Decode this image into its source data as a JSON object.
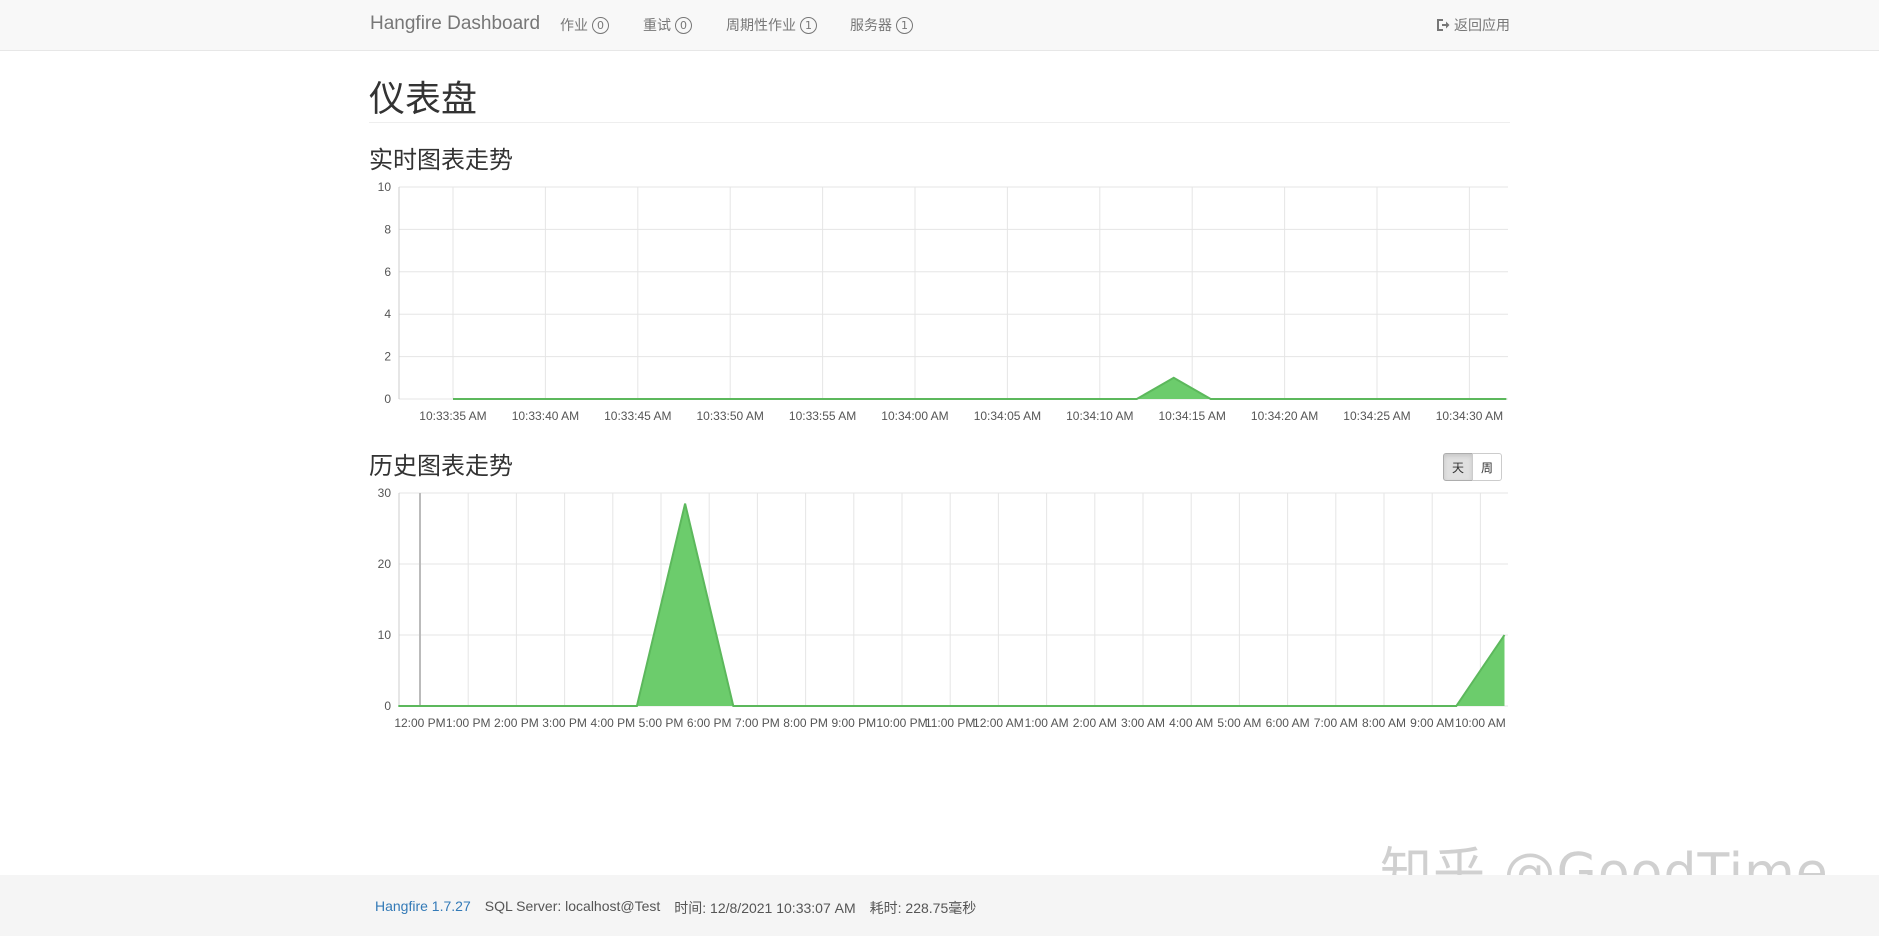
{
  "navbar": {
    "brand": "Hangfire Dashboard",
    "items": [
      {
        "label": "作业",
        "count": "0"
      },
      {
        "label": "重试",
        "count": "0"
      },
      {
        "label": "周期性作业",
        "count": "1"
      },
      {
        "label": "服务器",
        "count": "1"
      }
    ],
    "back_label": "返回应用",
    "back_icon": "sign-out-icon"
  },
  "page": {
    "title": "仪表盘",
    "realtime_title": "实时图表走势",
    "history_title": "历史图表走势"
  },
  "history_toggle": {
    "options": [
      "天",
      "周"
    ],
    "selected": "天"
  },
  "footer": {
    "version": "Hangfire 1.7.27",
    "storage": "SQL Server: localhost@Test",
    "time": "时间: 12/8/2021 10:33:07 AM",
    "duration": "耗时: 228.75毫秒"
  },
  "watermark": "知乎 @GoodTime",
  "colors": {
    "series_fill": "#6ccc6c",
    "series_stroke": "#5cb85c",
    "grid": "#e5e5e5"
  },
  "chart_data": [
    {
      "type": "area",
      "x": [
        "10:33:35 AM",
        "10:33:40 AM",
        "10:33:45 AM",
        "10:33:50 AM",
        "10:33:55 AM",
        "10:34:00 AM",
        "10:34:05 AM",
        "10:34:10 AM",
        "10:34:15 AM",
        "10:34:20 AM",
        "10:34:25 AM",
        "10:34:30 AM"
      ],
      "ylim": [
        0,
        10
      ],
      "yticks": [
        0,
        2,
        4,
        6,
        8,
        10
      ],
      "grid": true,
      "series": [
        {
          "points": [
            [
              0.0,
              0
            ],
            [
              7.0,
              0
            ],
            [
              7.4,
              0
            ],
            [
              7.8,
              1
            ],
            [
              8.2,
              0
            ],
            [
              11.4,
              0
            ]
          ]
        }
      ]
    },
    {
      "type": "area",
      "x": [
        "12:00 PM",
        "1:00 PM",
        "2:00 PM",
        "3:00 PM",
        "4:00 PM",
        "5:00 PM",
        "6:00 PM",
        "7:00 PM",
        "8:00 PM",
        "9:00 PM",
        "10:00 PM",
        "11:00 PM",
        "12:00 AM",
        "1:00 AM",
        "2:00 AM",
        "3:00 AM",
        "4:00 AM",
        "5:00 AM",
        "6:00 AM",
        "7:00 AM",
        "8:00 AM",
        "9:00 AM",
        "10:00 AM"
      ],
      "ylim": [
        0,
        30
      ],
      "yticks": [
        0,
        10,
        20,
        30
      ],
      "grid": true,
      "series": [
        {
          "points": [
            [
              -0.45,
              0
            ],
            [
              4.5,
              0
            ],
            [
              5.5,
              28.5
            ],
            [
              6.5,
              0
            ],
            [
              21.5,
              0
            ],
            [
              22.5,
              10
            ]
          ]
        }
      ]
    }
  ]
}
